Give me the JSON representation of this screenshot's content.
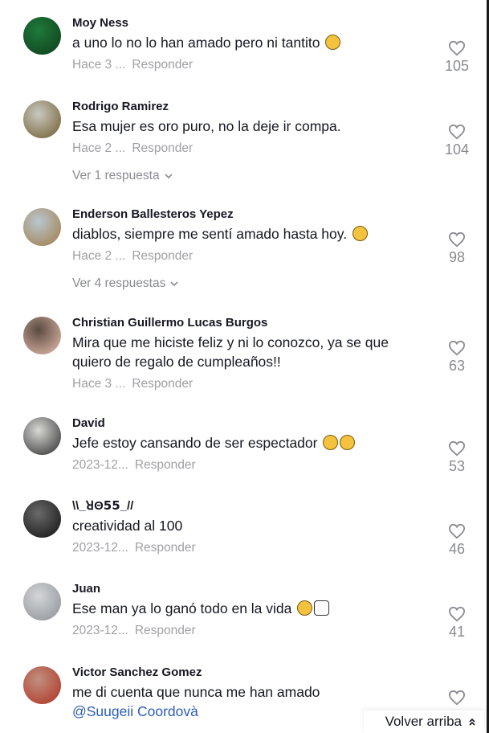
{
  "comments": [
    {
      "username": "Moy Ness",
      "text": "a uno lo no lo han amado pero ni tantito",
      "emoji": [
        "disappointed-face"
      ],
      "time": "Hace 3 ...",
      "reply": "Responder",
      "likes": "105",
      "avatar_colors": [
        "#1f7a3a",
        "#0e3d1c"
      ]
    },
    {
      "username": "Rodrigo Ramirez",
      "text": "Esa mujer es oro puro, no la deje ir compa.",
      "emoji": [],
      "time": "Hace 2 ...",
      "reply": "Responder",
      "likes": "104",
      "view_replies": "Ver 1 respuesta",
      "avatar_colors": [
        "#c9c8c0",
        "#6d5a2c"
      ]
    },
    {
      "username": "Enderson Ballesteros Yepez",
      "text": "diablos, siempre me sentí amado hasta hoy.",
      "emoji": [
        "upside-down-face"
      ],
      "time": "Hace 2 ...",
      "reply": "Responder",
      "likes": "98",
      "view_replies": "Ver 4 respuestas",
      "avatar_colors": [
        "#b9c7d0",
        "#a07a45"
      ]
    },
    {
      "username": "Christian Guillermo Lucas Burgos",
      "text": "Mira que me hiciste feliz y ni lo conozco, ya se que quiero de regalo de cumpleaños!!",
      "emoji": [],
      "time": "Hace 3 ...",
      "reply": "Responder",
      "likes": "63",
      "avatar_colors": [
        "#5a4a40",
        "#e8c0b0"
      ]
    },
    {
      "username": "David",
      "text": "Jefe estoy cansando de ser espectador",
      "emoji": [
        "pleading-face",
        "pleading-face"
      ],
      "time": "2023-12...",
      "reply": "Responder",
      "likes": "53",
      "avatar_colors": [
        "#d8d8d4",
        "#2a2a2a"
      ]
    },
    {
      "username": "\\\\_ꓤΘ𝟱𝟱_//",
      "text": "creatividad al 100",
      "emoji": [],
      "time": "2023-12...",
      "reply": "Responder",
      "likes": "46",
      "avatar_colors": [
        "#6a6a6a",
        "#101010"
      ]
    },
    {
      "username": "Juan",
      "text": "Ese man ya lo ganó todo en la vida",
      "emoji": [
        "astonished-face",
        "pointing-hand"
      ],
      "time": "2023-12...",
      "reply": "Responder",
      "likes": "41",
      "avatar_colors": [
        "#d4d6d8",
        "#8a8f94"
      ]
    },
    {
      "username": "Victor Sanchez Gomez",
      "text": "me di cuenta que nunca me han amado",
      "mention": "@Suugeii Coordovà",
      "emoji": [],
      "avatar_colors": [
        "#c09080",
        "#b03020"
      ]
    }
  ],
  "back_to_top": "Volver arriba",
  "colors": {
    "text": "#161823",
    "muted": "#a0a0a4",
    "mention": "#2b5db8"
  }
}
